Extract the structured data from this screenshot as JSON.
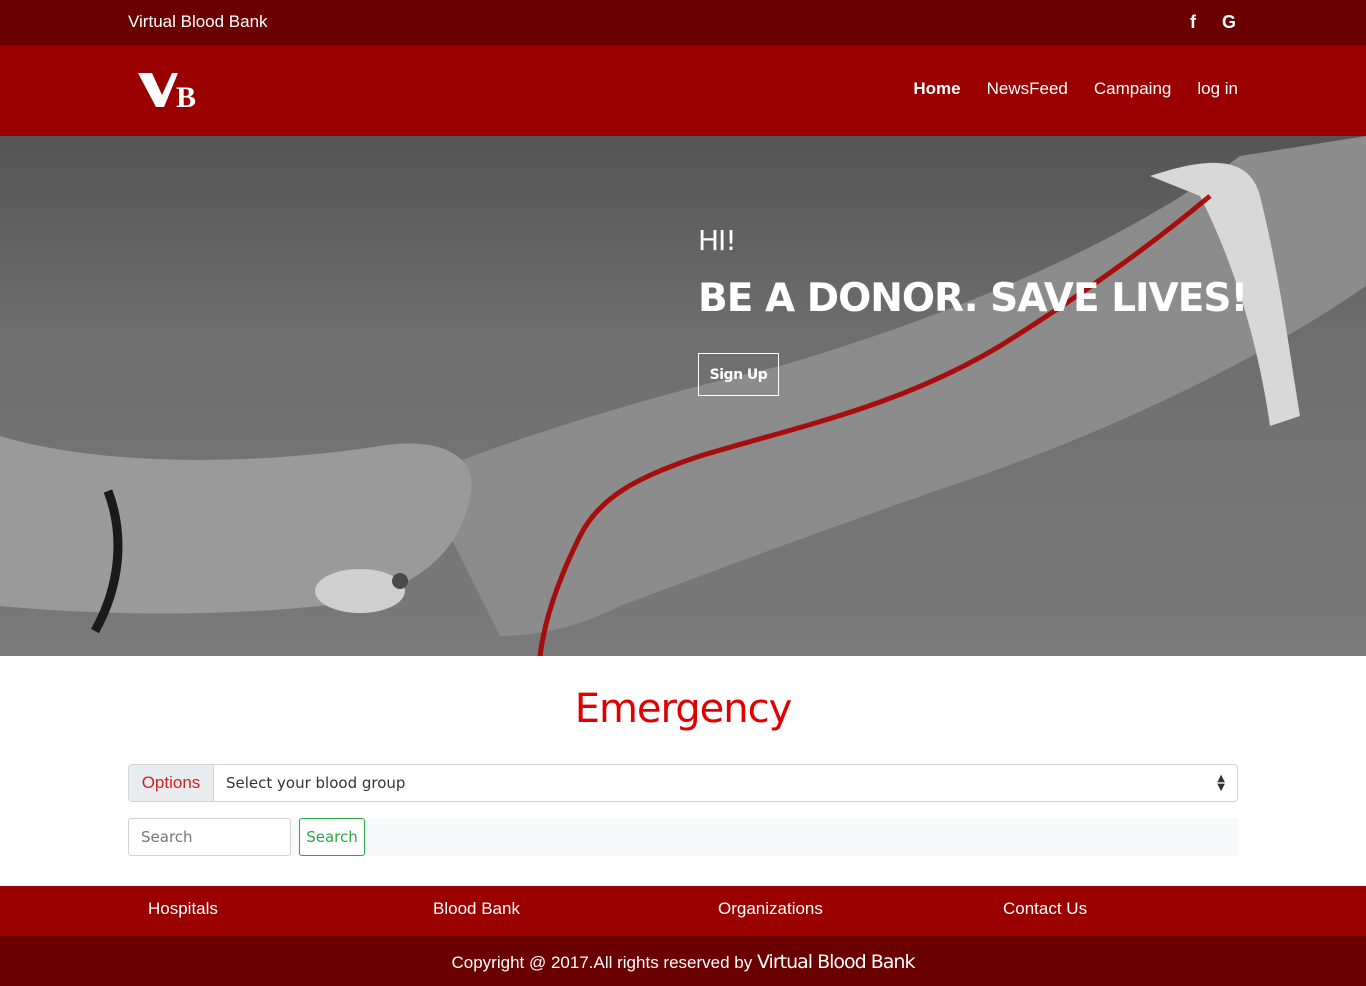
{
  "topbar": {
    "site_name": "Virtual Blood Bank",
    "social": [
      {
        "icon": "facebook-icon",
        "glyph": "f"
      },
      {
        "icon": "google-icon",
        "glyph": "G"
      }
    ]
  },
  "navbar": {
    "logo_text": "VB",
    "links": [
      {
        "label": "Home",
        "active": true
      },
      {
        "label": "NewsFeed",
        "active": false
      },
      {
        "label": "Campaing",
        "active": false
      },
      {
        "label": "log in",
        "active": false
      }
    ]
  },
  "hero": {
    "greeting": "HI!",
    "slogan": "BE A DONOR. SAVE LIVES!",
    "signup_label": "Sign Up"
  },
  "emergency": {
    "title": "Emergency",
    "options_label": "Options",
    "select_value": "Select your blood group",
    "search_placeholder": "Search",
    "search_button": "Search"
  },
  "footer": {
    "links": [
      "Hospitals",
      "Blood Bank",
      "Organizations",
      "Contact Us"
    ],
    "copyright_text": "Copyright @ 2017.All rights reserved by",
    "copyright_brand": "Virtual Blood Bank"
  },
  "colors": {
    "dark_red": "#6b0000",
    "red": "#9b0000",
    "accent_red": "#e00000",
    "success_green": "#28a745"
  }
}
